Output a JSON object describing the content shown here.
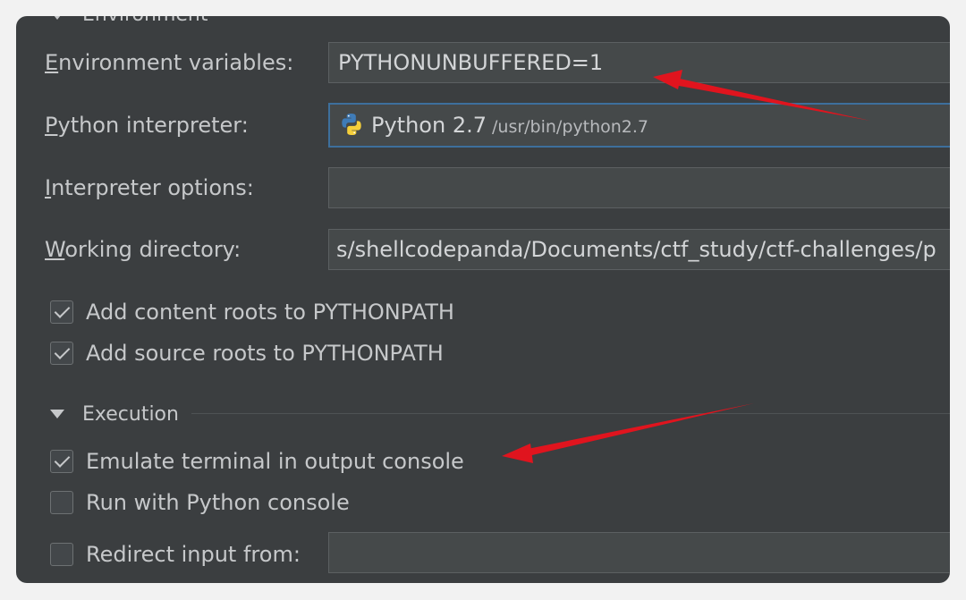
{
  "env_section": {
    "label": "Environment"
  },
  "fields": {
    "env_vars": {
      "label_prefix": "",
      "label_u": "E",
      "label_rest": "nvironment variables:",
      "value": "PYTHONUNBUFFERED=1"
    },
    "interpreter": {
      "label_u": "P",
      "label_rest": "ython interpreter:",
      "name": "Python 2.7",
      "path": "/usr/bin/python2.7"
    },
    "interp_options": {
      "label_u": "I",
      "label_rest": "nterpreter options:",
      "value": ""
    },
    "working_dir": {
      "label_u": "W",
      "label_rest": "orking directory:",
      "value": "s/shellcodepanda/Documents/ctf_study/ctf-challenges/p"
    }
  },
  "checkboxes": {
    "content_roots": {
      "label": "Add content roots to PYTHONPATH",
      "checked": true
    },
    "source_roots": {
      "label": "Add source roots to PYTHONPATH",
      "checked": true
    },
    "emulate_terminal": {
      "label": "Emulate terminal in output console",
      "checked": true
    },
    "python_console": {
      "label": "Run with Python console",
      "checked": false
    },
    "redirect_input": {
      "label": "Redirect input from:",
      "checked": false
    }
  },
  "execution_section": {
    "label": "Execution"
  },
  "colors": {
    "panel_bg": "#3b3e40",
    "focus_border": "#3d6f9c",
    "annotation_arrow": "#e0141e"
  },
  "icons": {
    "interpreter": "python-logo-icon",
    "expand": "triangle-down-icon"
  }
}
